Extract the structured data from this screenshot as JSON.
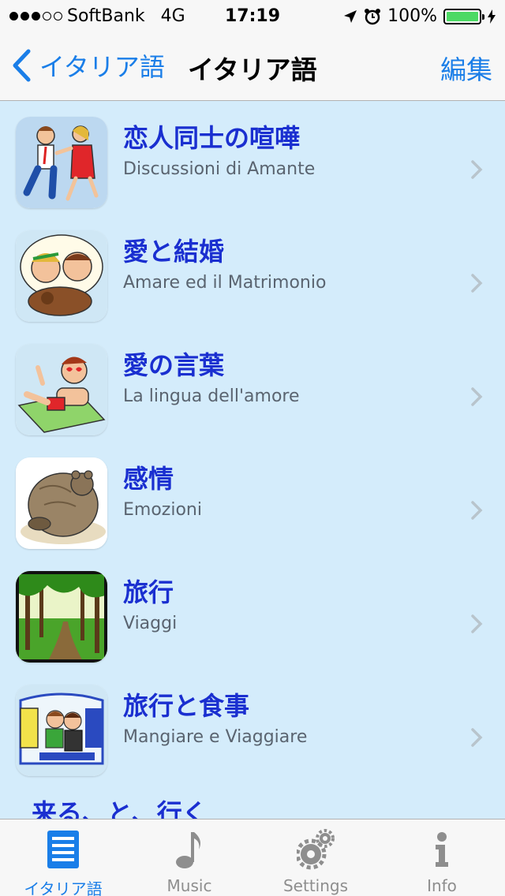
{
  "status": {
    "carrier": "SoftBank",
    "network": "4G",
    "time": "17:19",
    "battery": "100%"
  },
  "nav": {
    "back_label": "イタリア語",
    "title": "イタリア語",
    "edit_label": "編集"
  },
  "list": {
    "items": [
      {
        "title": "恋人同士の喧嘩",
        "subtitle": "Discussioni di Amante",
        "icon": "couple-argument-icon"
      },
      {
        "title": "愛と結婚",
        "subtitle": "Amare ed il Matrimonio",
        "icon": "couple-love-icon"
      },
      {
        "title": "愛の言葉",
        "subtitle": "La lingua dell'amore",
        "icon": "lovestruck-man-icon"
      },
      {
        "title": "感情",
        "subtitle": "Emozioni",
        "icon": "sad-bear-icon"
      },
      {
        "title": "旅行",
        "subtitle": "Viaggi",
        "icon": "forest-road-icon"
      },
      {
        "title": "旅行と食事",
        "subtitle": "Mangiare e Viaggiare",
        "icon": "train-travelers-icon"
      }
    ],
    "partial_title": "来る、と、行く"
  },
  "tabs": [
    {
      "label": "イタリア語",
      "icon": "list-icon",
      "active": true
    },
    {
      "label": "Music",
      "icon": "music-note-icon",
      "active": false
    },
    {
      "label": "Settings",
      "icon": "gears-icon",
      "active": false
    },
    {
      "label": "Info",
      "icon": "info-icon",
      "active": false
    }
  ],
  "colors": {
    "accent": "#1a7ee8",
    "title_text": "#1a2fd0",
    "list_background": "#d4ecfb",
    "battery": "#4cd964"
  }
}
